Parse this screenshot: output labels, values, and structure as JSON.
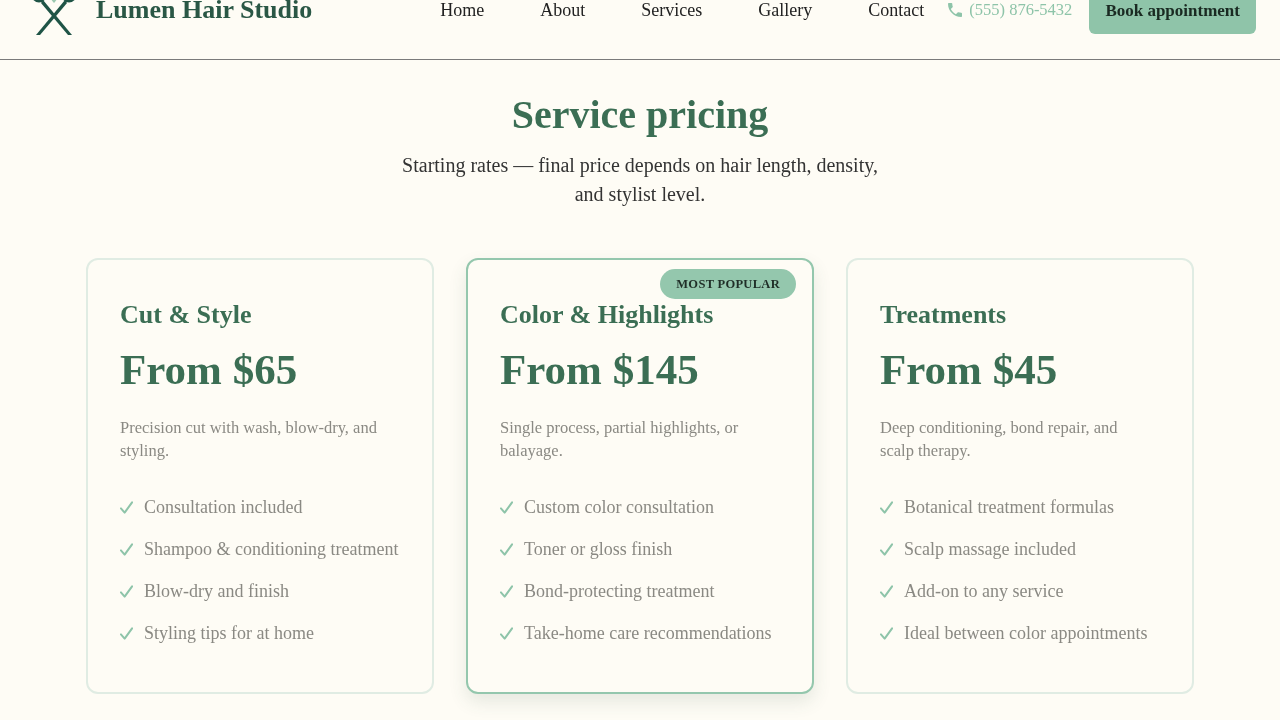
{
  "header": {
    "brand": "Lumen Hair Studio",
    "nav": [
      "Home",
      "About",
      "Services",
      "Gallery",
      "Contact"
    ],
    "phone": "(555) 876-5432",
    "cta": "Book appointment"
  },
  "pricing": {
    "title": "Service pricing",
    "subtitle": "Starting rates — final price depends on hair length, density, and stylist level.",
    "cards": [
      {
        "title": "Cut & Style",
        "price": "From $65",
        "description": "Precision cut with wash, blow-dry, and styling.",
        "features": [
          "Consultation included",
          "Shampoo & conditioning treatment",
          "Blow-dry and finish",
          "Styling tips for at home"
        ],
        "featured": false
      },
      {
        "title": "Color & Highlights",
        "price": "From $145",
        "description": "Single process, partial highlights, or balayage.",
        "features": [
          "Custom color consultation",
          "Toner or gloss finish",
          "Bond-protecting treatment",
          "Take-home care recommendations"
        ],
        "featured": true,
        "badge": "MOST POPULAR"
      },
      {
        "title": "Treatments",
        "price": "From $45",
        "description": "Deep conditioning, bond repair, and scalp therapy.",
        "features": [
          "Botanical treatment formulas",
          "Scalp massage included",
          "Add-on to any service",
          "Ideal between color appointments"
        ],
        "featured": false
      }
    ]
  }
}
